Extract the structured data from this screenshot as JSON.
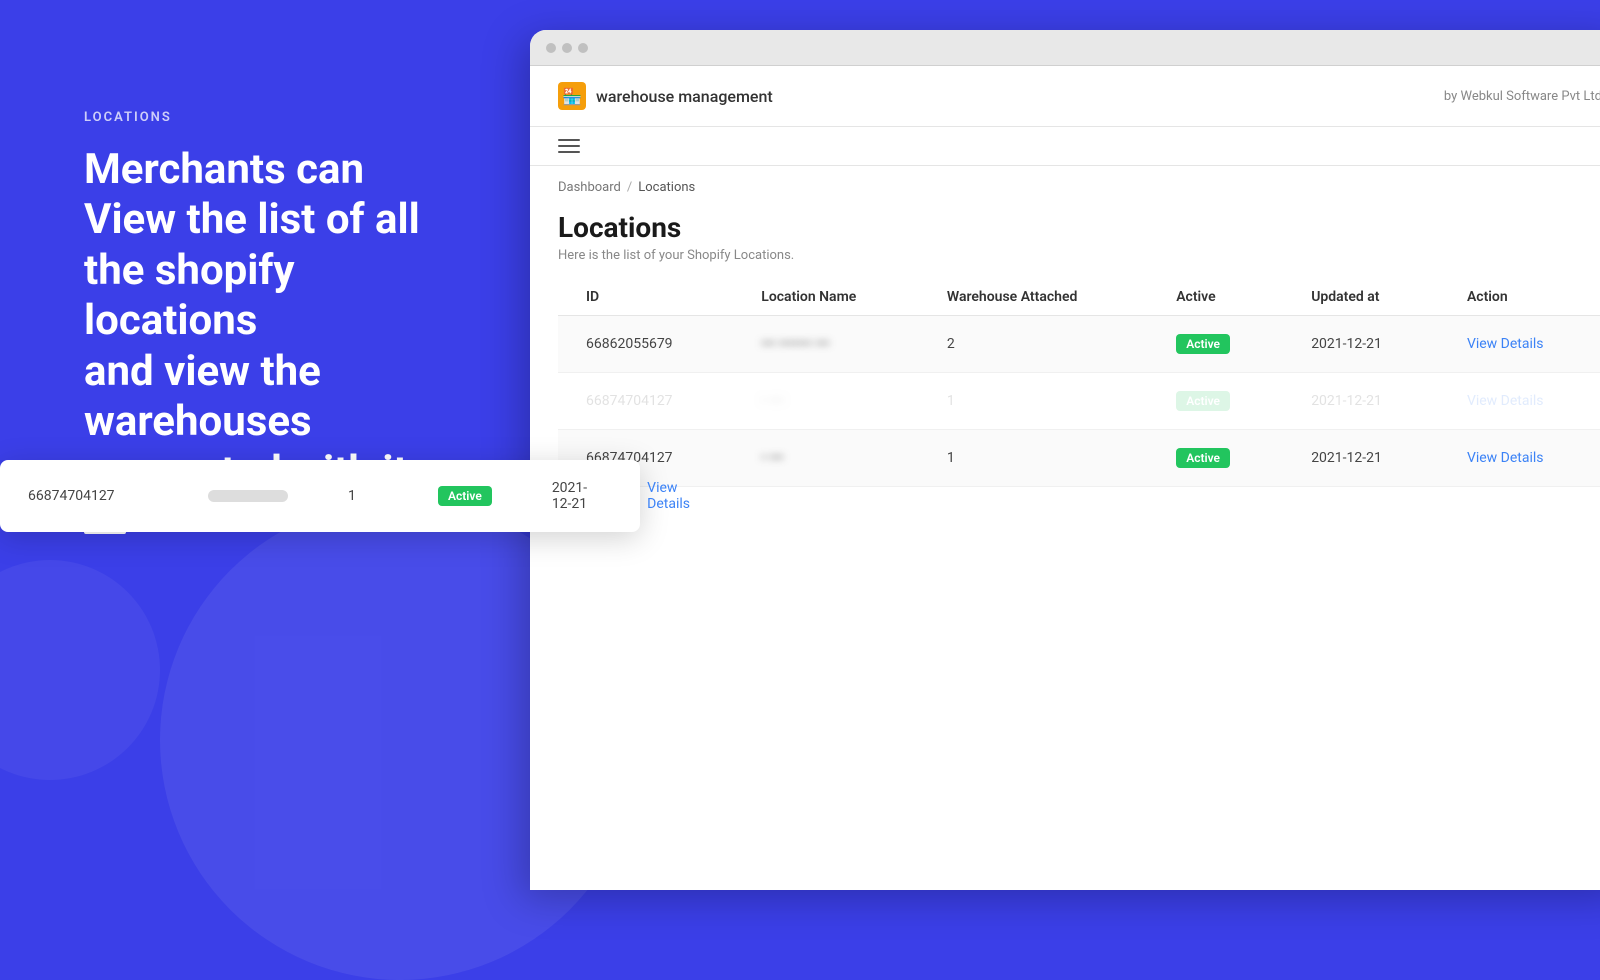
{
  "left": {
    "label": "LOCATIONS",
    "heading_line1": "Merchants can",
    "heading_line2": "View the list of all",
    "heading_line3": "the shopify locations",
    "heading_line4": "and view the",
    "heading_line5": "warehouses",
    "heading_line6": "connected with it"
  },
  "browser": {
    "dot1": "",
    "dot2": "",
    "dot3": ""
  },
  "app": {
    "logo_text": "warehouse management",
    "header_right": "by Webkul Software Pvt Ltd",
    "breadcrumb_home": "Dashboard",
    "breadcrumb_separator": "/",
    "breadcrumb_current": "Locations",
    "page_title": "Locations",
    "page_subtitle": "Here is the list of your Shopify Locations.",
    "table": {
      "headers": {
        "id": "ID",
        "location_name": "Location Name",
        "warehouse_attached": "Warehouse Attached",
        "active": "Active",
        "updated_at": "Updated at",
        "action": "Action"
      },
      "rows": [
        {
          "id": "66862055679",
          "location_name": "••• ••••••• •••",
          "warehouse_attached": "2",
          "active": "Active",
          "updated_at": "2021-12-21",
          "action": "View Details"
        },
        {
          "id": "66874704127",
          "location_name": "• •••",
          "warehouse_attached": "1",
          "active": "Active",
          "updated_at": "2021-12-21",
          "action": "View Details"
        },
        {
          "id": "66874704127",
          "location_name": "• •••",
          "warehouse_attached": "1",
          "active": "Active",
          "updated_at": "2021-12-21",
          "action": "View Details"
        }
      ]
    },
    "floating_row": {
      "id": "66874704127",
      "warehouse_attached": "1",
      "active": "Active",
      "updated_at": "2021-12-21",
      "action": "View Details"
    }
  }
}
